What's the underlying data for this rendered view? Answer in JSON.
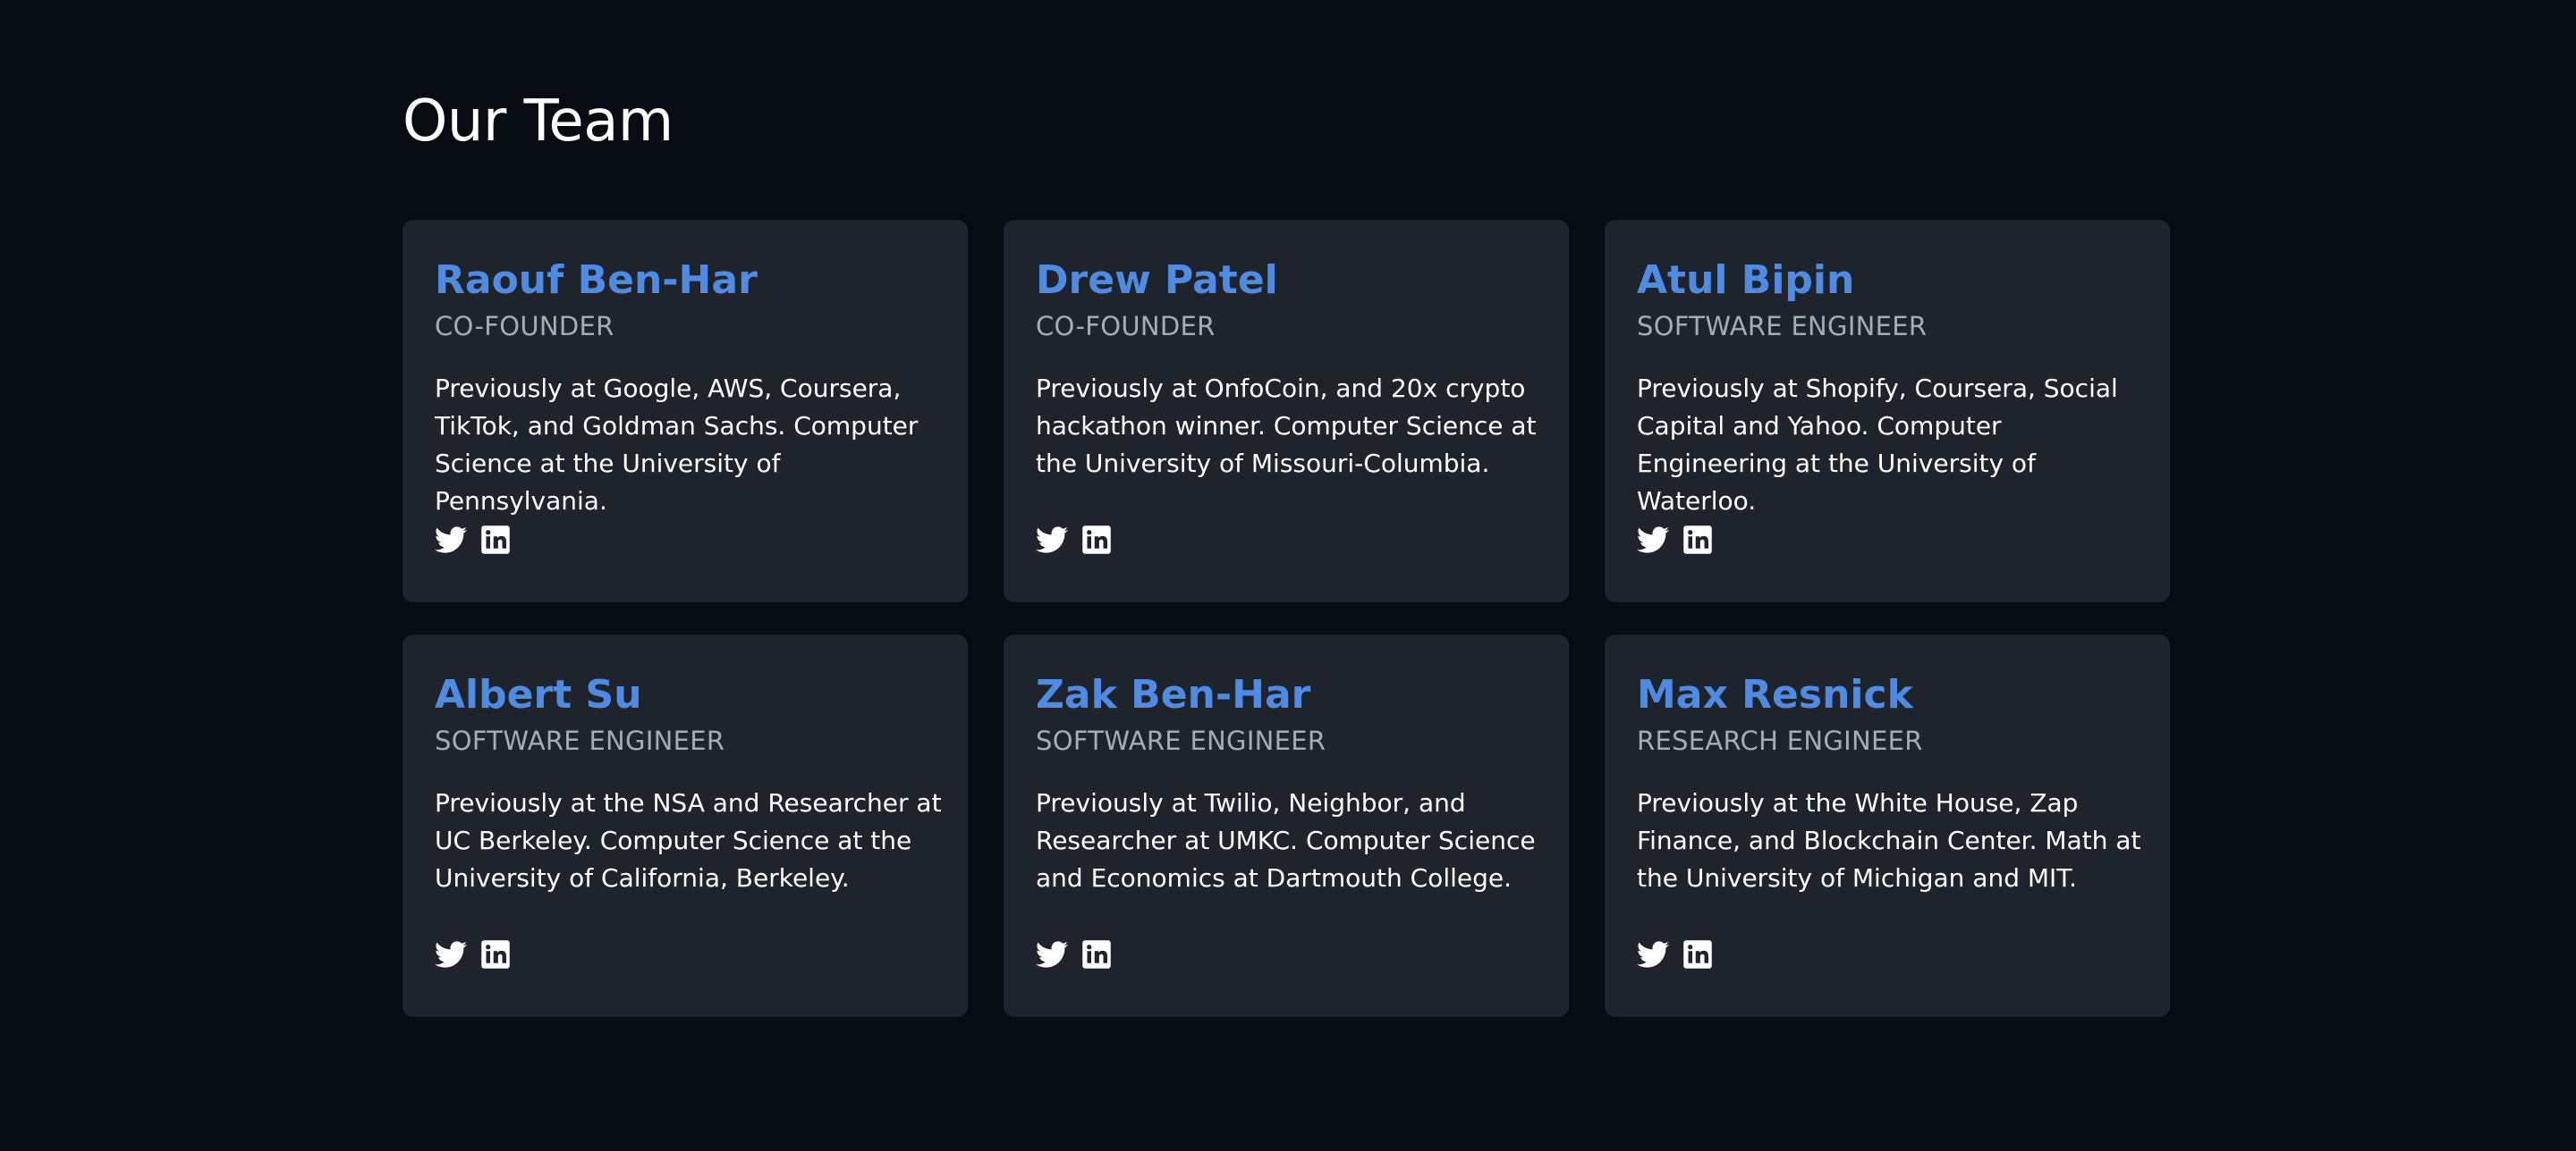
{
  "page": {
    "title": "Our Team"
  },
  "colors": {
    "background": "#070c13",
    "card": "#1f232b",
    "accent": "#4f8be3",
    "role_text": "#a7abb2",
    "body_text": "#ffffff"
  },
  "social_icons": [
    "twitter-icon",
    "linkedin-icon"
  ],
  "team": [
    {
      "name": "Raouf Ben-Har",
      "role": "CO-FOUNDER",
      "bio": "Previously at Google, AWS, Coursera, TikTok, and Goldman Sachs. Computer Science at the University of Pennsylvania."
    },
    {
      "name": "Drew Patel",
      "role": "CO-FOUNDER",
      "bio": "Previously at OnfoCoin, and 20x crypto hackathon winner. Computer Science at the University of Missouri-Columbia."
    },
    {
      "name": "Atul Bipin",
      "role": "SOFTWARE ENGINEER",
      "bio": "Previously at Shopify, Coursera, Social Capital and Yahoo. Computer Engineering at the University of Waterloo."
    },
    {
      "name": "Albert Su",
      "role": "SOFTWARE ENGINEER",
      "bio": "Previously at the NSA and Researcher at UC Berkeley. Computer Science at the University of California, Berkeley."
    },
    {
      "name": "Zak Ben-Har",
      "role": "SOFTWARE ENGINEER",
      "bio": "Previously at Twilio, Neighbor, and Researcher at UMKC. Computer Science and Economics at Dartmouth College."
    },
    {
      "name": "Max Resnick",
      "role": "RESEARCH ENGINEER",
      "bio": "Previously at the White House, Zap Finance, and Blockchain Center. Math at the University of Michigan and MIT."
    }
  ]
}
